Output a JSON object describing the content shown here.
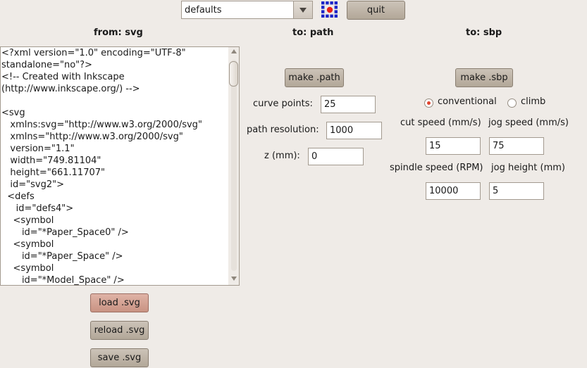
{
  "toolbar": {
    "preset_value": "defaults",
    "quit_label": "quit"
  },
  "columns": {
    "from_header": "from: svg",
    "to_path_header": "to: path",
    "to_sbp_header": "to: sbp"
  },
  "svg_editor": {
    "content": "<?xml version=\"1.0\" encoding=\"UTF-8\" standalone=\"no\"?>\n<!-- Created with Inkscape (http://www.inkscape.org/) -->\n\n<svg\n   xmlns:svg=\"http://www.w3.org/2000/svg\"\n   xmlns=\"http://www.w3.org/2000/svg\"\n   version=\"1.1\"\n   width=\"749.81104\"\n   height=\"661.11707\"\n   id=\"svg2\">\n  <defs\n     id=\"defs4\">\n    <symbol\n       id=\"*Paper_Space0\" />\n    <symbol\n       id=\"*Paper_Space\" />\n    <symbol\n       id=\"*Model_Space\" />"
  },
  "svg_buttons": {
    "load_label": "load .svg",
    "reload_label": "reload .svg",
    "save_label": "save .svg"
  },
  "path_panel": {
    "make_label": "make .path",
    "curve_points_label": "curve points:",
    "curve_points_value": "25",
    "path_resolution_label": "path resolution:",
    "path_resolution_value": "1000",
    "z_label": "z (mm):",
    "z_value": "0"
  },
  "sbp_panel": {
    "make_label": "make .sbp",
    "mode_options": [
      "conventional",
      "climb"
    ],
    "selected_mode": "conventional",
    "cut_speed_label": "cut speed (mm/s)",
    "cut_speed_value": "15",
    "jog_speed_label": "jog speed (mm/s)",
    "jog_speed_value": "75",
    "spindle_speed_label": "spindle speed (RPM)",
    "spindle_speed_value": "10000",
    "jog_height_label": "jog height (mm)",
    "jog_height_value": "5"
  },
  "colors": {
    "background": "#efebe7",
    "button": "#c1b8ac",
    "button_highlight": "#d6a596",
    "radio_dot": "#e0452f",
    "logo_red": "#e8201a",
    "logo_blue": "#1a24c8"
  }
}
